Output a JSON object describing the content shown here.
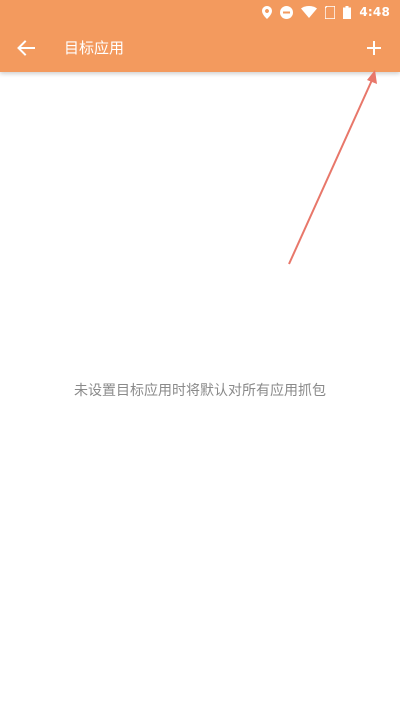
{
  "status_bar": {
    "time": "4:48",
    "icons": [
      "location-icon",
      "do-not-disturb-icon",
      "wifi-icon",
      "sim-icon",
      "battery-icon"
    ]
  },
  "toolbar": {
    "title": "目标应用",
    "back_icon": "arrow-left-icon",
    "add_icon": "plus-icon"
  },
  "main": {
    "empty_message": "未设置目标应用时将默认对所有应用抓包"
  },
  "colors": {
    "appbar": "#F39A5E",
    "annotation_arrow": "#E8776A",
    "empty_text": "#8a8a8a"
  }
}
